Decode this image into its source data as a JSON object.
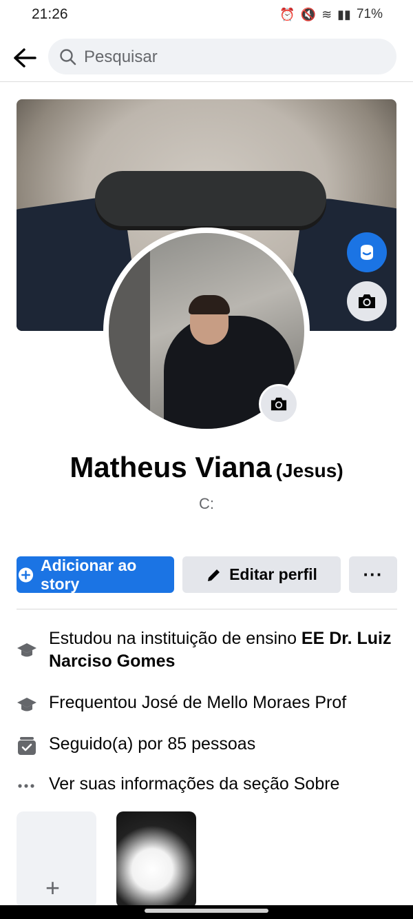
{
  "status": {
    "time": "21:26",
    "battery": "71%"
  },
  "search": {
    "placeholder": "Pesquisar"
  },
  "profile": {
    "name": "Matheus Viana",
    "alternate_name": "(Jesus)",
    "bio": "C:"
  },
  "actions": {
    "add_story": "Adicionar ao story",
    "edit_profile": "Editar perfil",
    "more": "···"
  },
  "details": [
    {
      "icon": "graduation-cap-icon",
      "text": "Estudou na instituição de ensino ",
      "bold": "EE Dr. Luiz Narciso Gomes"
    },
    {
      "icon": "graduation-cap-icon",
      "text": "Frequentou José de Mello Moraes Prof"
    },
    {
      "icon": "followers-icon",
      "text": "Seguido(a) por 85 pessoas"
    },
    {
      "icon": "more-dots-icon",
      "text": "Ver suas informações da seção Sobre"
    }
  ],
  "tiles": {
    "add": "+"
  },
  "colors": {
    "accent": "#1b74e4",
    "button_gray": "#e4e6eb",
    "secondary_text": "#65676b"
  }
}
